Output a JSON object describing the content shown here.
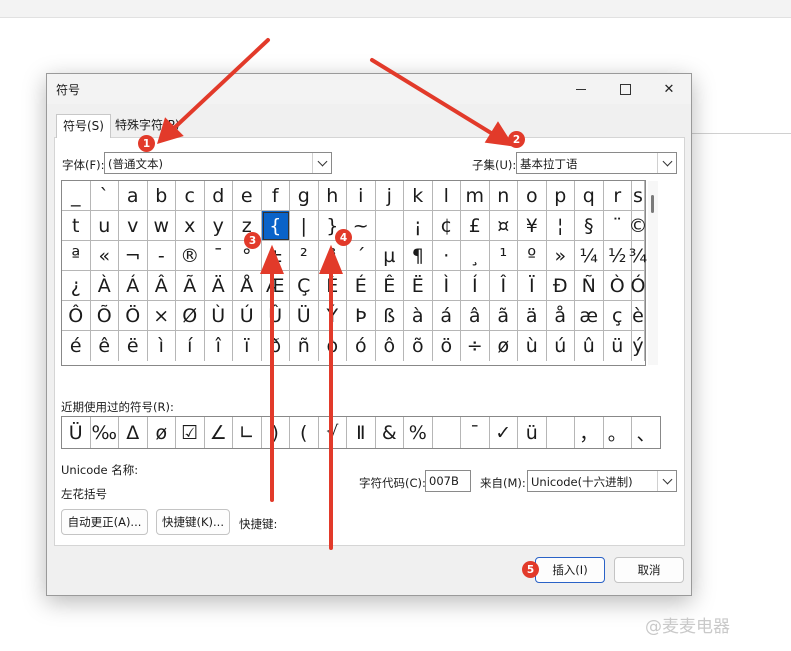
{
  "dialog": {
    "title": "符号",
    "buttons": {
      "minimize": "—",
      "maximize": "□",
      "close": "✕"
    }
  },
  "tabs": [
    {
      "label": "符号(S)",
      "active": true
    },
    {
      "label": "特殊字符(P)",
      "active": false
    }
  ],
  "font": {
    "label": "字体(F):",
    "value": "(普通文本)"
  },
  "subset": {
    "label": "子集(U):",
    "value": "基本拉丁语"
  },
  "symbol_grid": {
    "selected": "{",
    "rows": [
      [
        "_",
        "`",
        "a",
        "b",
        "c",
        "d",
        "e",
        "f",
        "g",
        "h",
        "i",
        "j",
        "k",
        "l",
        "m",
        "n",
        "o",
        "p",
        "q",
        "r",
        "s"
      ],
      [
        "t",
        "u",
        "v",
        "w",
        "x",
        "y",
        "z",
        "{",
        "|",
        "}",
        "~",
        " ",
        "¡",
        "¢",
        "£",
        "¤",
        "¥",
        "¦",
        "§",
        "¨",
        "©"
      ],
      [
        "ª",
        "«",
        "¬",
        "-",
        "®",
        "¯",
        "°",
        "±",
        "²",
        "³",
        "´",
        "µ",
        "¶",
        "·",
        "¸",
        "¹",
        "º",
        "»",
        "¼",
        "½",
        "¾"
      ],
      [
        "¿",
        "À",
        "Á",
        "Â",
        "Ã",
        "Ä",
        "Å",
        "Æ",
        "Ç",
        "È",
        "É",
        "Ê",
        "Ë",
        "Ì",
        "Í",
        "Î",
        "Ï",
        "Ð",
        "Ñ",
        "Ò",
        "Ó"
      ],
      [
        "Ô",
        "Õ",
        "Ö",
        "×",
        "Ø",
        "Ù",
        "Ú",
        "Û",
        "Ü",
        "Ý",
        "Þ",
        "ß",
        "à",
        "á",
        "â",
        "ã",
        "ä",
        "å",
        "æ",
        "ç",
        "è"
      ],
      [
        "é",
        "ê",
        "ë",
        "ì",
        "í",
        "î",
        "ï",
        "ð",
        "ñ",
        "ò",
        "ó",
        "ô",
        "õ",
        "ö",
        "÷",
        "ø",
        "ù",
        "ú",
        "û",
        "ü",
        "ý"
      ]
    ]
  },
  "recent": {
    "label": "近期使用过的符号(R):",
    "symbols": [
      "Ü",
      "‰",
      "Δ",
      "ø",
      "☑",
      "∠",
      "∟",
      ")",
      "(",
      "√",
      "Ⅱ",
      "&",
      "%",
      " ",
      "¯",
      "✓",
      "ü",
      " ",
      "，",
      "。",
      "、"
    ]
  },
  "unicode_name": {
    "label": "Unicode 名称:",
    "value": "左花括号"
  },
  "char_code": {
    "label": "字符代码(C):",
    "value": "007B"
  },
  "from": {
    "label": "来自(M):",
    "value": "Unicode(十六进制)"
  },
  "autocorrect_button": "自动更正(A)...",
  "shortcut_key_button": "快捷键(K)...",
  "shortcut_key_label": "快捷键:",
  "insert_button": "插入(I)",
  "cancel_button": "取消",
  "annotations": {
    "color": "#e23a2a",
    "badges": [
      "1",
      "2",
      "3",
      "4",
      "5"
    ]
  },
  "watermark": "@麦麦电器"
}
